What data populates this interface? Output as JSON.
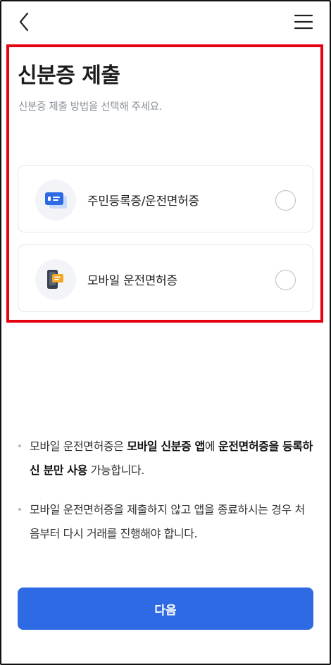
{
  "header": {
    "back_icon": "chevron-left-icon",
    "menu_icon": "hamburger-menu-icon"
  },
  "title": "신분증 제출",
  "subtitle": "신분증 제출 방법을 선택해 주세요.",
  "options": [
    {
      "label": "주민등록증/운전면허증",
      "icon": "id-card-icon",
      "selected": false
    },
    {
      "label": "모바일 운전면허증",
      "icon": "mobile-license-icon",
      "selected": false
    }
  ],
  "notices": [
    {
      "parts": [
        {
          "text": "모바일 운전면허증은 ",
          "bold": false
        },
        {
          "text": "모바일 신분증 앱",
          "bold": true
        },
        {
          "text": "에 ",
          "bold": false
        },
        {
          "text": "운전면허증을 등록하신 분만 사용",
          "bold": true
        },
        {
          "text": " 가능합니다.",
          "bold": false
        }
      ]
    },
    {
      "parts": [
        {
          "text": "모바일 운전면허증을 제출하지 않고 앱을 종료하시는 경우 처음부터 다시 거래를 진행해야 합니다.",
          "bold": false
        }
      ]
    }
  ],
  "next_button": "다음",
  "colors": {
    "primary": "#2d6ae3",
    "highlight_border": "#e50012",
    "card_border": "#e3e6ea",
    "subtitle_text": "#8a8f98"
  }
}
